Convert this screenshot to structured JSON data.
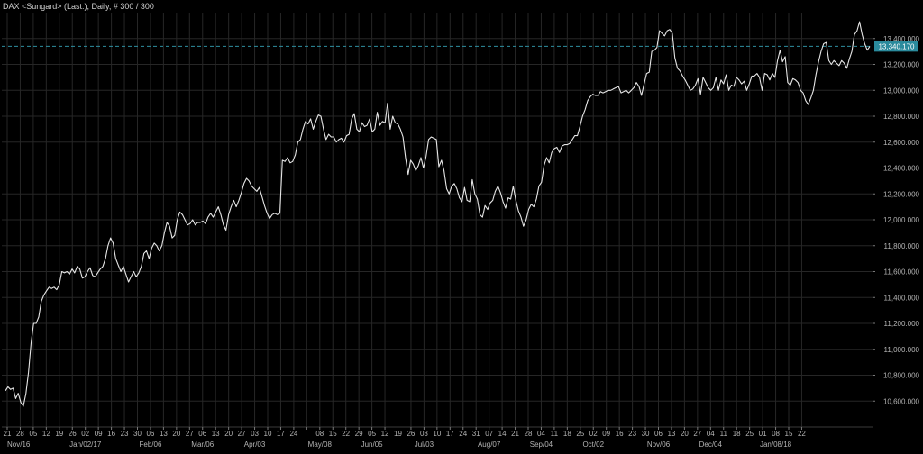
{
  "title": "DAX <Sungard> (Last:), Daily, # 300 / 300",
  "chart_data": {
    "type": "line",
    "title": "DAX <Sungard> (Last:), Daily, # 300 / 300",
    "xlabel": "",
    "ylabel": "",
    "ylim": [
      10400,
      13600
    ],
    "grid": true,
    "last_value": 13340.17,
    "last_value_label": "13,340.170",
    "colors": {
      "background": "#000000",
      "line": "#e6e6e6",
      "grid": "#262626",
      "last_line": "#2e8fa0",
      "last_badge": "#2a8a9c"
    },
    "yticks": [
      {
        "value": 10600,
        "label": "10,600.000"
      },
      {
        "value": 10800,
        "label": "10,800.000"
      },
      {
        "value": 11000,
        "label": "11,000.000"
      },
      {
        "value": 11200,
        "label": "11,200.000"
      },
      {
        "value": 11400,
        "label": "11,400.000"
      },
      {
        "value": 11600,
        "label": "11,600.000"
      },
      {
        "value": 11800,
        "label": "11,800.000"
      },
      {
        "value": 12000,
        "label": "12,000.000"
      },
      {
        "value": 12200,
        "label": "12,200.000"
      },
      {
        "value": 12400,
        "label": "12,400.000"
      },
      {
        "value": 12600,
        "label": "12,600.000"
      },
      {
        "value": 12800,
        "label": "12,800.000"
      },
      {
        "value": 13000,
        "label": "13,000.000"
      },
      {
        "value": 13200,
        "label": "13,200.000"
      },
      {
        "value": 13400,
        "label": "13,400.000"
      }
    ],
    "xticks": [
      "21",
      "28",
      "05",
      "12",
      "19",
      "26",
      "02",
      "09",
      "16",
      "23",
      "30",
      "06",
      "13",
      "20",
      "27",
      "06",
      "13",
      "20",
      "27",
      "03",
      "10",
      "17",
      "24",
      "",
      "08",
      "15",
      "22",
      "29",
      "05",
      "12",
      "19",
      "26",
      "03",
      "10",
      "17",
      "24",
      "31",
      "07",
      "14",
      "21",
      "28",
      "04",
      "11",
      "18",
      "25",
      "02",
      "09",
      "16",
      "23",
      "30",
      "06",
      "13",
      "20",
      "27",
      "04",
      "11",
      "18",
      "25",
      "01",
      "08",
      "15",
      "22"
    ],
    "month_labels": [
      {
        "label": "Nov/16",
        "tick": 0
      },
      {
        "label": "Jan/02/17",
        "tick": 6
      },
      {
        "label": "Feb/06",
        "tick": 11
      },
      {
        "label": "Mar/06",
        "tick": 15
      },
      {
        "label": "Apr/03",
        "tick": 19
      },
      {
        "label": "May/08",
        "tick": 24
      },
      {
        "label": "Jun/05",
        "tick": 28
      },
      {
        "label": "Jul/03",
        "tick": 32
      },
      {
        "label": "Aug/07",
        "tick": 37
      },
      {
        "label": "Sep/04",
        "tick": 41
      },
      {
        "label": "Oct/02",
        "tick": 45
      },
      {
        "label": "Nov/06",
        "tick": 50
      },
      {
        "label": "Dec/04",
        "tick": 54
      },
      {
        "label": "Jan/08/18",
        "tick": 59
      }
    ],
    "values": [
      10680,
      10710,
      10690,
      10700,
      10620,
      10660,
      10590,
      10560,
      10660,
      10820,
      11050,
      11200,
      11200,
      11250,
      11370,
      11420,
      11450,
      11480,
      11470,
      11480,
      11460,
      11500,
      11600,
      11590,
      11600,
      11580,
      11620,
      11590,
      11640,
      11620,
      11550,
      11560,
      11600,
      11630,
      11570,
      11560,
      11590,
      11620,
      11640,
      11700,
      11800,
      11860,
      11820,
      11700,
      11650,
      11600,
      11640,
      11580,
      11520,
      11560,
      11600,
      11560,
      11590,
      11640,
      11740,
      11760,
      11700,
      11780,
      11820,
      11800,
      11760,
      11800,
      11900,
      11980,
      11950,
      11860,
      11880,
      12000,
      12060,
      12040,
      12000,
      11960,
      11970,
      12000,
      11960,
      11980,
      11980,
      11990,
      11970,
      12020,
      12050,
      12020,
      12060,
      12100,
      12040,
      11960,
      11920,
      12040,
      12100,
      12150,
      12100,
      12150,
      12210,
      12280,
      12320,
      12300,
      12260,
      12240,
      12220,
      12250,
      12180,
      12110,
      12050,
      12010,
      12040,
      12050,
      12040,
      12050,
      12460,
      12450,
      12480,
      12440,
      12450,
      12500,
      12600,
      12620,
      12700,
      12760,
      12740,
      12780,
      12700,
      12760,
      12810,
      12800,
      12700,
      12620,
      12660,
      12640,
      12640,
      12600,
      12620,
      12630,
      12600,
      12650,
      12660,
      12780,
      12820,
      12700,
      12680,
      12750,
      12720,
      12730,
      12780,
      12680,
      12700,
      12830,
      12730,
      12760,
      12750,
      12900,
      12700,
      12800,
      12750,
      12740,
      12700,
      12640,
      12480,
      12350,
      12460,
      12430,
      12380,
      12420,
      12480,
      12400,
      12490,
      12620,
      12640,
      12630,
      12620,
      12410,
      12460,
      12380,
      12240,
      12200,
      12260,
      12280,
      12240,
      12170,
      12140,
      12250,
      12150,
      12140,
      12310,
      12200,
      12160,
      12040,
      12020,
      12110,
      12080,
      12130,
      12150,
      12220,
      12260,
      12210,
      12140,
      12090,
      12170,
      12160,
      12260,
      12150,
      12070,
      12020,
      11950,
      12000,
      12080,
      12120,
      12100,
      12160,
      12260,
      12290,
      12420,
      12480,
      12440,
      12520,
      12550,
      12560,
      12520,
      12570,
      12580,
      12580,
      12590,
      12620,
      12650,
      12650,
      12720,
      12800,
      12850,
      12920,
      12950,
      12970,
      12960,
      12960,
      12990,
      12980,
      12990,
      13000,
      13000,
      13010,
      13020,
      13030,
      12980,
      12990,
      13000,
      12980,
      13000,
      13020,
      13060,
      13030,
      12960,
      13050,
      13130,
      13140,
      13300,
      13310,
      13330,
      13460,
      13440,
      13420,
      13460,
      13470,
      13440,
      13250,
      13170,
      13150,
      13110,
      13080,
      13040,
      13000,
      13010,
      13040,
      13090,
      12970,
      13100,
      13060,
      13020,
      13000,
      13020,
      13100,
      13000,
      13080,
      13050,
      13120,
      13000,
      13040,
      13030,
      13100,
      13080,
      13050,
      13070,
      13000,
      13050,
      13110,
      13110,
      13130,
      13100,
      13000,
      13130,
      13120,
      13080,
      13130,
      13100,
      13230,
      13310,
      13220,
      13260,
      13060,
      13040,
      13090,
      13080,
      13060,
      13000,
      12980,
      12920,
      12890,
      12940,
      13000,
      13120,
      13220,
      13300,
      13360,
      13370,
      13230,
      13200,
      13230,
      13210,
      13190,
      13230,
      13210,
      13170,
      13240,
      13300,
      13430,
      13460,
      13530,
      13430,
      13360,
      13310,
      13340
    ]
  }
}
